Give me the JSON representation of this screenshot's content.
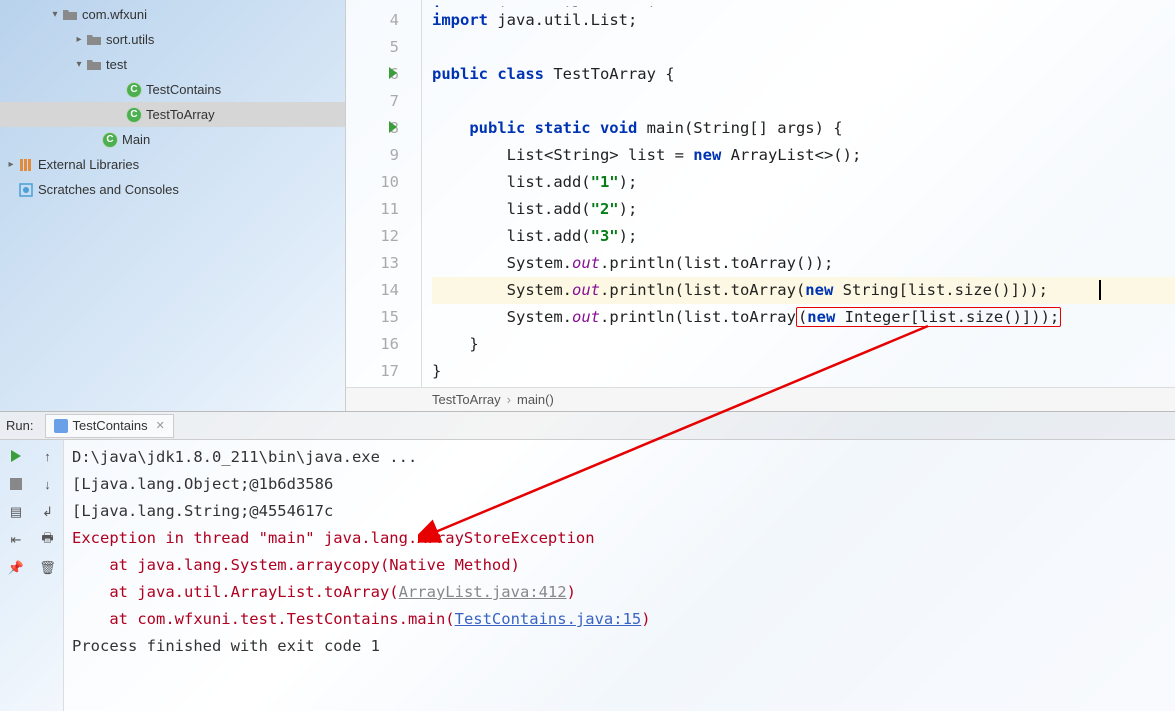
{
  "sidebar": {
    "items": [
      {
        "indent": 48,
        "chev": "v",
        "icon": "folder",
        "label": "com.wfxuni"
      },
      {
        "indent": 72,
        "chev": ">",
        "icon": "folder",
        "label": "sort.utils"
      },
      {
        "indent": 72,
        "chev": "v",
        "icon": "folder",
        "label": "test"
      },
      {
        "indent": 112,
        "chev": "",
        "icon": "class",
        "label": "TestContains"
      },
      {
        "indent": 112,
        "chev": "",
        "icon": "class",
        "label": "TestToArray",
        "selected": true
      },
      {
        "indent": 88,
        "chev": "",
        "icon": "class",
        "label": "Main"
      },
      {
        "indent": 4,
        "chev": ">",
        "icon": "lib",
        "label": "External Libraries"
      },
      {
        "indent": 4,
        "chev": "",
        "icon": "scratch",
        "label": "Scratches and Consoles"
      }
    ]
  },
  "editor": {
    "gutter_start": 3,
    "run_markers": [
      6,
      8
    ],
    "lines": [
      {
        "n": 3,
        "tokens": [
          {
            "cls": "kw",
            "t": "import"
          },
          {
            "cls": "plain",
            "t": " java.util.ArrayList;"
          }
        ],
        "hidden_top": true
      },
      {
        "n": 4,
        "tokens": [
          {
            "cls": "kw",
            "t": "import"
          },
          {
            "cls": "plain",
            "t": " java.util.List;"
          }
        ]
      },
      {
        "n": 5,
        "tokens": []
      },
      {
        "n": 6,
        "tokens": [
          {
            "cls": "kw",
            "t": "public class"
          },
          {
            "cls": "plain",
            "t": " TestToArray {"
          }
        ]
      },
      {
        "n": 7,
        "tokens": []
      },
      {
        "n": 8,
        "tokens": [
          {
            "cls": "plain",
            "t": "    "
          },
          {
            "cls": "kw",
            "t": "public static void"
          },
          {
            "cls": "plain",
            "t": " main(String[] args) {"
          }
        ]
      },
      {
        "n": 9,
        "tokens": [
          {
            "cls": "plain",
            "t": "        List<String> list = "
          },
          {
            "cls": "kw",
            "t": "new"
          },
          {
            "cls": "plain",
            "t": " ArrayList<>();"
          }
        ]
      },
      {
        "n": 10,
        "tokens": [
          {
            "cls": "plain",
            "t": "        list.add("
          },
          {
            "cls": "str",
            "t": "\"1\""
          },
          {
            "cls": "plain",
            "t": ");"
          }
        ]
      },
      {
        "n": 11,
        "tokens": [
          {
            "cls": "plain",
            "t": "        list.add("
          },
          {
            "cls": "str",
            "t": "\"2\""
          },
          {
            "cls": "plain",
            "t": ");"
          }
        ]
      },
      {
        "n": 12,
        "tokens": [
          {
            "cls": "plain",
            "t": "        list.add("
          },
          {
            "cls": "str",
            "t": "\"3\""
          },
          {
            "cls": "plain",
            "t": ");"
          }
        ]
      },
      {
        "n": 13,
        "tokens": [
          {
            "cls": "plain",
            "t": "        System."
          },
          {
            "cls": "field",
            "t": "out"
          },
          {
            "cls": "plain",
            "t": ".println(list.toArray());"
          }
        ]
      },
      {
        "n": 14,
        "hl": true,
        "caret": true,
        "tokens": [
          {
            "cls": "plain",
            "t": "        System."
          },
          {
            "cls": "field",
            "t": "out"
          },
          {
            "cls": "plain",
            "t": ".println(list.toArray("
          },
          {
            "cls": "kw",
            "t": "new"
          },
          {
            "cls": "plain",
            "t": " String[list.size()]));"
          }
        ]
      },
      {
        "n": 15,
        "tokens": [
          {
            "cls": "plain",
            "t": "        System."
          },
          {
            "cls": "field",
            "t": "out"
          },
          {
            "cls": "plain",
            "t": ".println(list.toArray"
          },
          {
            "cls": "redbox",
            "inner": [
              {
                "cls": "plain",
                "t": "("
              },
              {
                "cls": "kw",
                "t": "new"
              },
              {
                "cls": "plain",
                "t": " Integer[list.size()]));"
              }
            ]
          }
        ]
      },
      {
        "n": 16,
        "tokens": [
          {
            "cls": "plain",
            "t": "    }"
          }
        ]
      },
      {
        "n": 17,
        "tokens": [
          {
            "cls": "plain",
            "t": "}"
          }
        ]
      }
    ],
    "breadcrumb": {
      "class": "TestToArray",
      "method": "main()"
    }
  },
  "run": {
    "label": "Run:",
    "tab": "TestContains",
    "console": [
      {
        "cls": "",
        "text": "D:\\java\\jdk1.8.0_211\\bin\\java.exe ..."
      },
      {
        "cls": "",
        "text": "[Ljava.lang.Object;@1b6d3586"
      },
      {
        "cls": "",
        "text": "[Ljava.lang.String;@4554617c"
      },
      {
        "cls": "err",
        "text": "Exception in thread \"main\" java.lang.ArrayStoreException"
      },
      {
        "cls": "err",
        "text": "    at java.lang.System.arraycopy(Native Method)"
      },
      {
        "cls": "err",
        "text": "    at java.util.ArrayList.toArray(",
        "greylink": "ArrayList.java:412",
        "tail": ")"
      },
      {
        "cls": "err",
        "text": "    at com.wfxuni.test.TestContains.main(",
        "link": "TestContains.java:15",
        "tail": ")"
      },
      {
        "cls": "",
        "text": ""
      },
      {
        "cls": "",
        "text": "Process finished with exit code 1"
      }
    ]
  }
}
